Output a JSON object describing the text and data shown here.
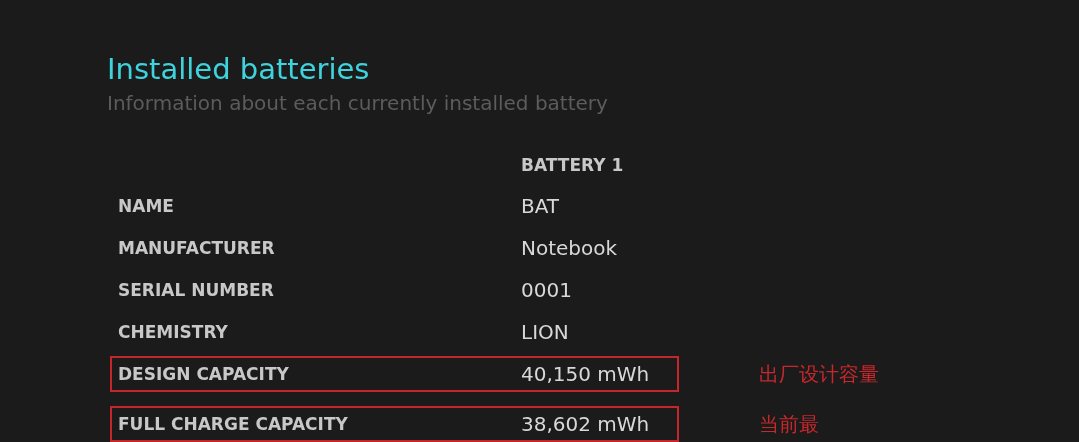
{
  "section": {
    "title": "Installed batteries",
    "subtitle": "Information about each currently installed battery"
  },
  "table": {
    "columns": [
      "BATTERY 1"
    ],
    "rows": [
      {
        "label": "NAME",
        "value": "BAT",
        "boxed": false
      },
      {
        "label": "MANUFACTURER",
        "value": "Notebook",
        "boxed": false
      },
      {
        "label": "SERIAL NUMBER",
        "value": "0001",
        "boxed": false
      },
      {
        "label": "CHEMISTRY",
        "value": "LION",
        "boxed": false
      },
      {
        "label": "DESIGN CAPACITY",
        "value": "40,150 mWh",
        "boxed": true,
        "note": "出厂设计容量"
      },
      {
        "label": "FULL CHARGE CAPACITY",
        "value": "38,602 mWh",
        "boxed": true,
        "note": "当前最"
      }
    ]
  }
}
